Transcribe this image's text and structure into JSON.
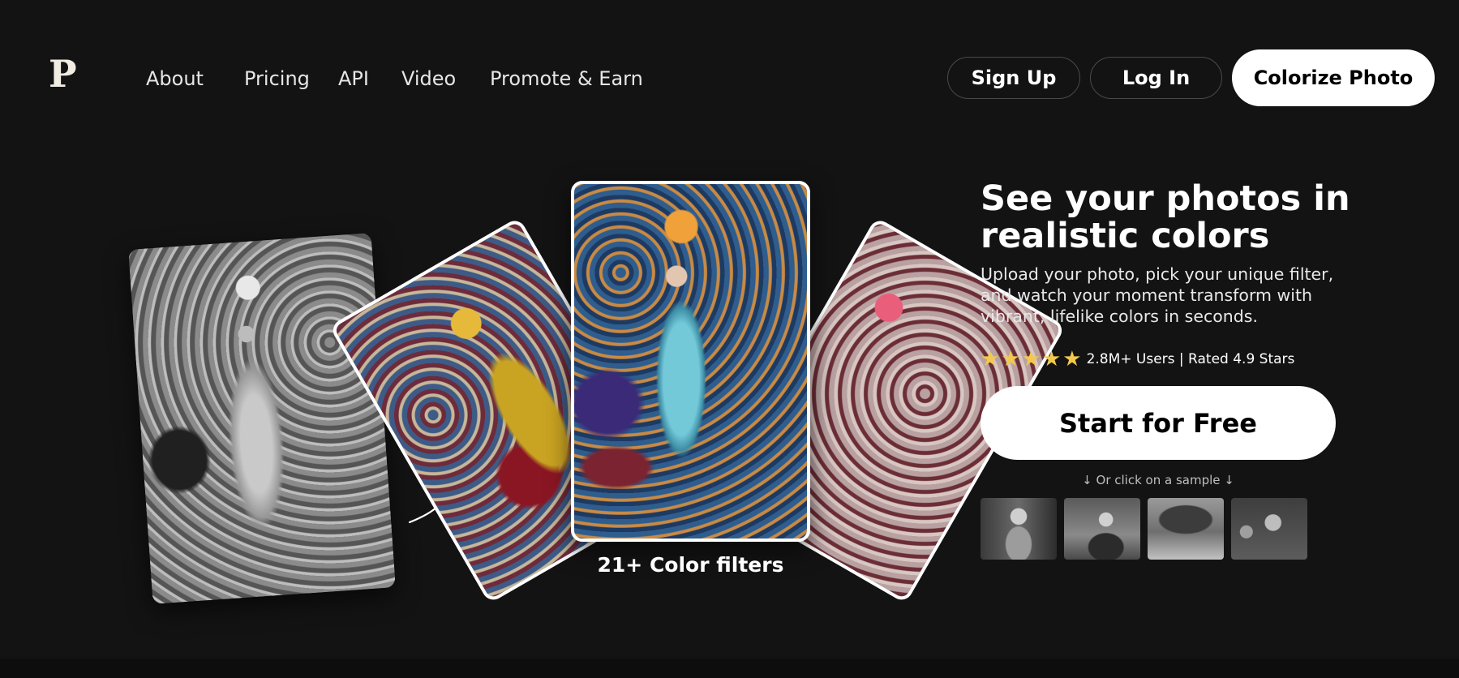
{
  "header": {
    "logo": "P",
    "nav": [
      "About",
      "Pricing",
      "API",
      "Video",
      "Promote & Earn"
    ],
    "sign_up": "Sign Up",
    "log_in": "Log In",
    "colorize": "Colorize Photo"
  },
  "hero": {
    "title": "See your photos in realistic colors",
    "subtitle": "Upload your photo, pick your unique filter, and watch your moment transform with vibrant, lifelike colors in seconds.",
    "stars": 5,
    "rating_text": "2.8M+ Users | Rated 4.9 Stars",
    "cta": "Start for Free",
    "sample_hint": "↓ Or click on a sample ↓"
  },
  "showcase": {
    "caption": "21+ Color filters"
  },
  "colors": {
    "background": "#141314",
    "star": "#f2c94c",
    "button": "#ffffff"
  }
}
